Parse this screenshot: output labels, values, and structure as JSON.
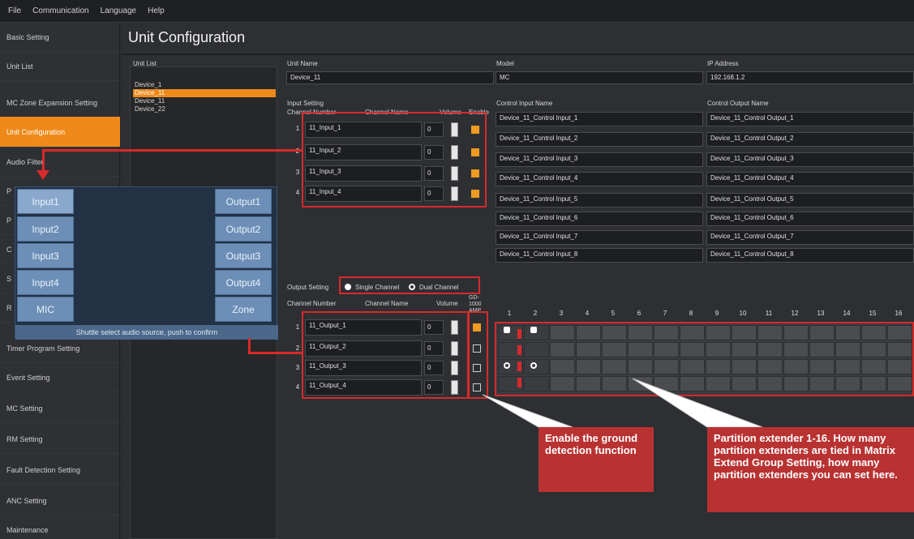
{
  "menubar": [
    "File",
    "Communication",
    "Language",
    "Help"
  ],
  "sidebar": {
    "items": [
      "Basic Setting",
      "Unit List",
      "MC Zone Expansion Setting",
      "Unit Configuration",
      "Audio Filter",
      "P",
      "P",
      "C",
      "S",
      "R",
      "Timer Program Setting",
      "Event Setting",
      "MC Setting",
      "RM Setting",
      "Fault Detection Setting",
      "ANC Setting",
      "Maintenance"
    ],
    "active_index": 3
  },
  "page_title": "Unit Configuration",
  "unit_list": {
    "label": "Unit List",
    "items": [
      "Device_1",
      "Device_11",
      "Device_11",
      "Device_22"
    ],
    "selected_index": 1
  },
  "unit": {
    "name_label": "Unit Name",
    "name_value": "Device_11",
    "model_label": "Model",
    "model_value": "MC",
    "ip_label": "IP Address",
    "ip_value": "192.168.1.2"
  },
  "input_setting": {
    "label": "Input Setting",
    "col_channel": "Channel Number",
    "col_name": "Channel Name",
    "col_volume": "Volume",
    "col_enable": "Enable",
    "rows": [
      {
        "n": "1",
        "name": "11_Input_1",
        "vol": "0",
        "enabled": true
      },
      {
        "n": "2",
        "name": "11_Input_2",
        "vol": "0",
        "enabled": true
      },
      {
        "n": "3",
        "name": "11_Input_3",
        "vol": "0",
        "enabled": true
      },
      {
        "n": "4",
        "name": "11_Input_4",
        "vol": "0",
        "enabled": true
      }
    ]
  },
  "control_input": {
    "label": "Control Input Name",
    "items": [
      "Device_11_Control Input_1",
      "Device_11_Control Input_2",
      "Device_11_Control Input_3",
      "Device_11_Control Input_4",
      "Device_11_Control Input_5",
      "Device_11_Control Input_6",
      "Device_11_Control Input_7",
      "Device_11_Control Input_8"
    ]
  },
  "control_output": {
    "label": "Control Output Name",
    "items": [
      "Device_11_Control Output_1",
      "Device_11_Control Output_2",
      "Device_11_Control Output_3",
      "Device_11_Control Output_4",
      "Device_11_Control Output_5",
      "Device_11_Control Output_6",
      "Device_11_Control Output_7",
      "Device_11_Control Output_8"
    ]
  },
  "output_setting": {
    "label": "Output Setting",
    "single": "Single Channel",
    "dual": "Dual Channel",
    "col_channel": "Channel Number",
    "col_name": "Channel Name",
    "col_volume": "Volume",
    "col_gd": "GD-1000 AMP",
    "rows": [
      {
        "n": "1",
        "name": "11_Output_1",
        "vol": "0",
        "enabled": true
      },
      {
        "n": "2",
        "name": "11_Output_2",
        "vol": "0",
        "enabled": false
      },
      {
        "n": "3",
        "name": "11_Output_3",
        "vol": "0",
        "enabled": false
      },
      {
        "n": "4",
        "name": "11_Output_4",
        "vol": "0",
        "enabled": false
      }
    ]
  },
  "matrix_headers": [
    "1",
    "2",
    "3",
    "4",
    "5",
    "6",
    "7",
    "8",
    "9",
    "10",
    "11",
    "12",
    "13",
    "14",
    "15",
    "16"
  ],
  "popup": {
    "inputs": [
      "Input1",
      "Input2",
      "Input3",
      "Input4",
      "MIC"
    ],
    "outputs": [
      "Output1",
      "Output2",
      "Output3",
      "Output4",
      "Zone"
    ],
    "footer": "Shuttle select audio source, push to confirm"
  },
  "callouts": {
    "ground": "Enable the ground detection function",
    "partition": "Partition extender 1-16. How many partition extenders are tied in Matrix Extend Group Setting, how many  partition extenders you can set here."
  },
  "colors": {
    "accent": "#ef8a1a",
    "annotation_red": "#d82a2a",
    "callout_bg": "#b93232",
    "popup_btn": "#6d8fb7"
  }
}
